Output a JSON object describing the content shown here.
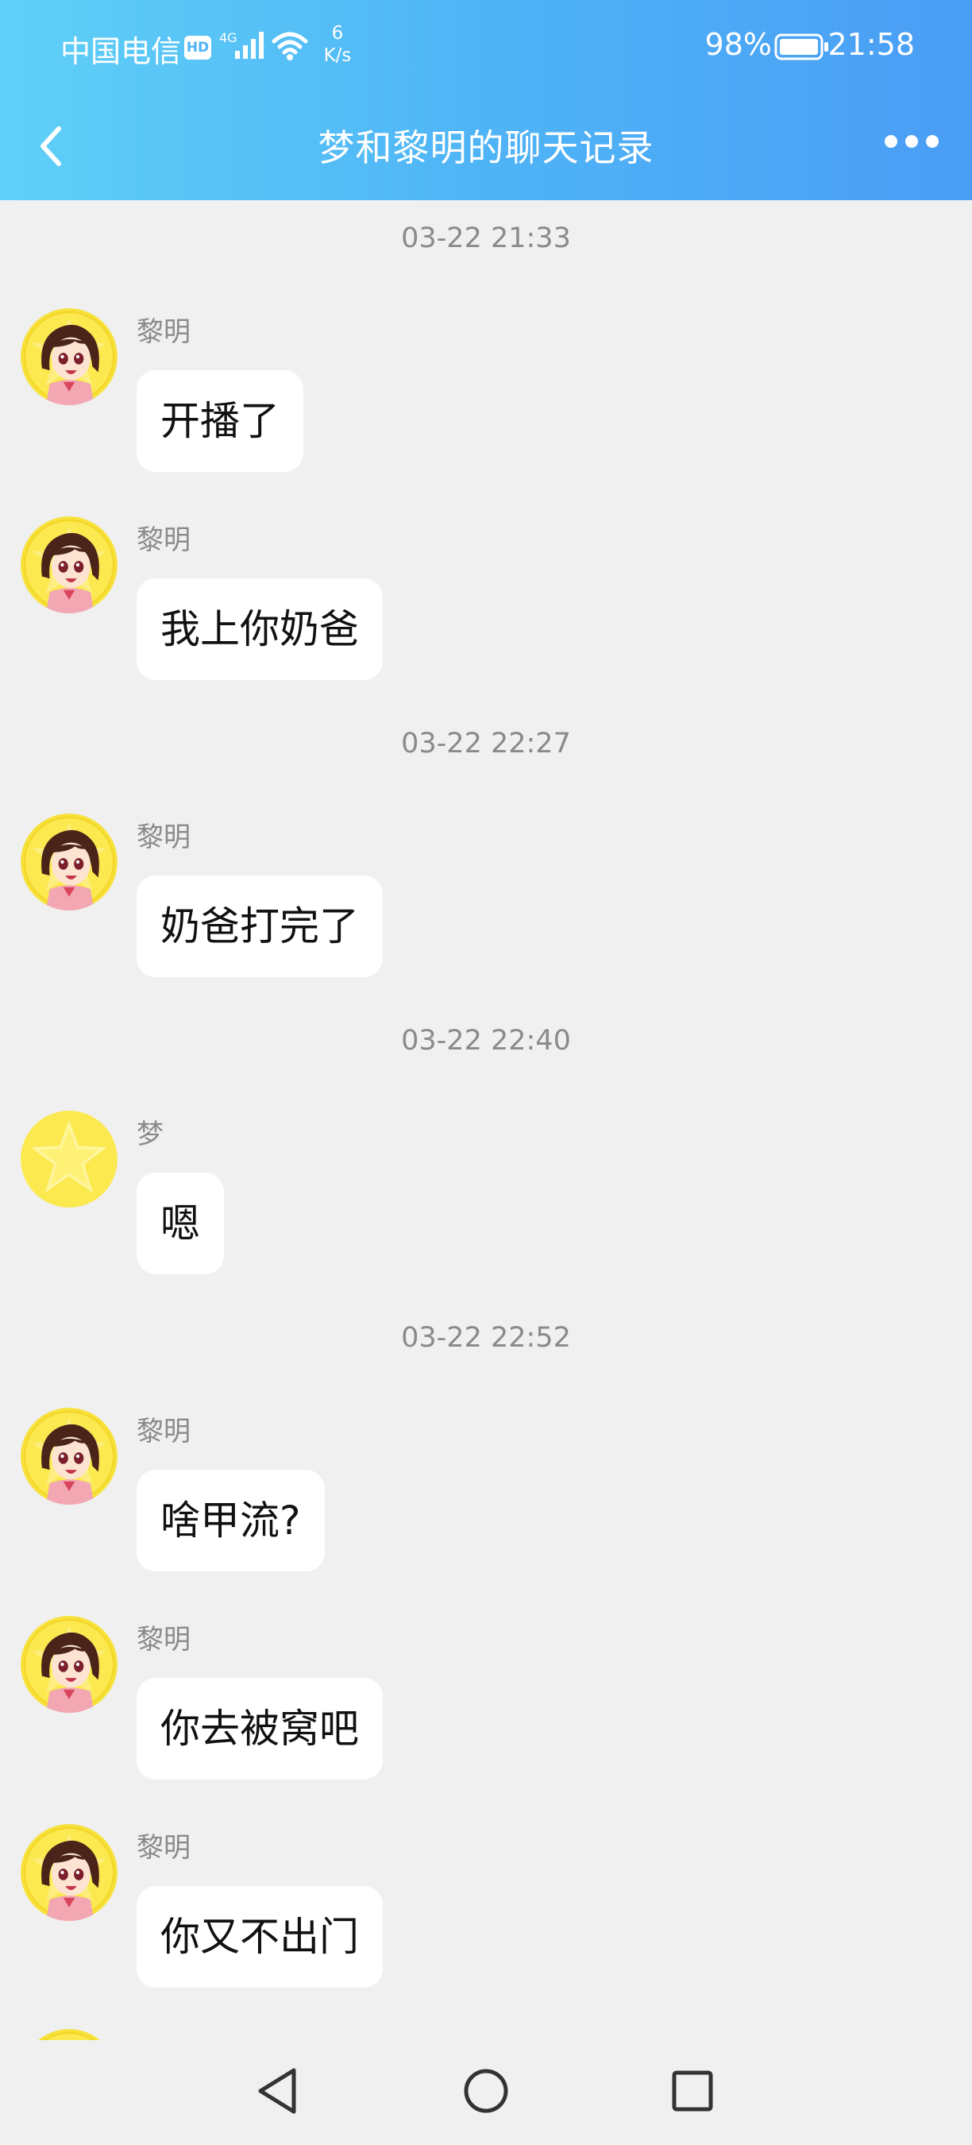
{
  "status_bar": {
    "carrier": "中国电信",
    "hd_badge": "HD",
    "network": "4G",
    "net_speed_value": "6",
    "net_speed_unit": "K/s",
    "battery": "98%",
    "time": "21:58",
    "icons": [
      "signal-icon",
      "wifi-icon",
      "battery-icon"
    ]
  },
  "header": {
    "title": "梦和黎明的聊天记录",
    "icons": [
      "back-arrow-icon",
      "more-dots-icon"
    ]
  },
  "chat": {
    "timestamps": [
      "03-22 21:33",
      "03-22 22:27",
      "03-22 22:40",
      "03-22 22:52"
    ],
    "messages": [
      {
        "sender": "黎明",
        "text": "开播了",
        "avatar": "anime-girl-avatar"
      },
      {
        "sender": "黎明",
        "text": "我上你奶爸",
        "avatar": "anime-girl-avatar"
      },
      {
        "sender": "黎明",
        "text": "奶爸打完了",
        "avatar": "anime-girl-avatar"
      },
      {
        "sender": "梦",
        "text": "嗯",
        "avatar": "yellow-star-avatar"
      },
      {
        "sender": "黎明",
        "text": "啥甲流?",
        "avatar": "anime-girl-avatar"
      },
      {
        "sender": "黎明",
        "text": "你去被窝吧",
        "avatar": "anime-girl-avatar"
      },
      {
        "sender": "黎明",
        "text": "你又不出门",
        "avatar": "anime-girl-avatar"
      }
    ]
  },
  "nav": {
    "icons": [
      "nav-back-icon",
      "nav-home-icon",
      "nav-recent-icon"
    ]
  },
  "colors": {
    "header_gradient_start": "#5fd0f7",
    "header_gradient_end": "#4a9df5",
    "background": "#f0f0f0",
    "bubble": "#ffffff",
    "meta_text": "#8a8a8a"
  }
}
